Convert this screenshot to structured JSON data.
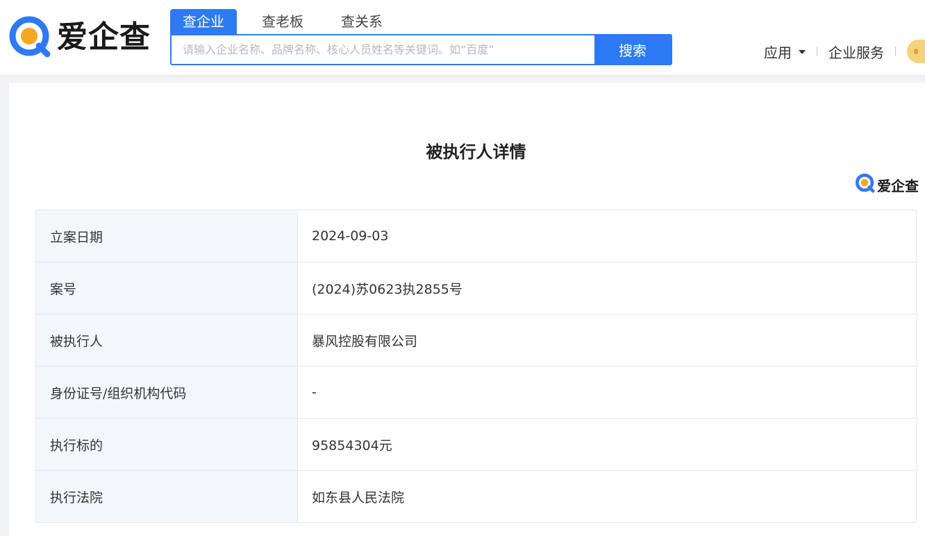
{
  "brand": {
    "name": "爱企查",
    "colors": {
      "primary": "#2d7af5",
      "logo_ring": "#2d7af5",
      "logo_accent": "#f5a623"
    }
  },
  "search": {
    "tabs": [
      {
        "label": "查企业",
        "active": true
      },
      {
        "label": "查老板",
        "active": false
      },
      {
        "label": "查关系",
        "active": false
      }
    ],
    "placeholder": "请输入企业名称、品牌名称、核心人员姓名等关键词。如“百度”",
    "button_label": "搜索"
  },
  "nav": {
    "apps_label": "应用",
    "enterprise_service_label": "企业服务"
  },
  "detail": {
    "title": "被执行人详情",
    "rows": [
      {
        "label": "立案日期",
        "value": "2024-09-03"
      },
      {
        "label": "案号",
        "value": "(2024)苏0623执2855号"
      },
      {
        "label": "被执行人",
        "value": "暴风控股有限公司"
      },
      {
        "label": "身份证号/组织机构代码",
        "value": "-"
      },
      {
        "label": "执行标的",
        "value": "95854304元"
      },
      {
        "label": "执行法院",
        "value": "如东县人民法院"
      }
    ]
  }
}
